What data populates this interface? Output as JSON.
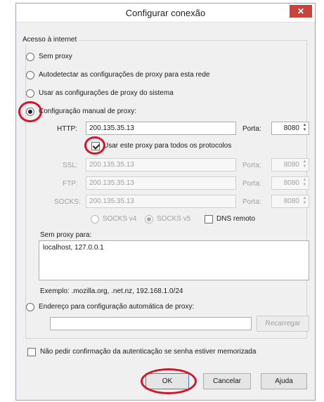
{
  "window": {
    "title": "Configurar conexão",
    "close_glyph": "✕"
  },
  "group": {
    "legend": "Acesso à internet"
  },
  "proxy_mode": {
    "options": [
      {
        "label": "Sem proxy",
        "checked": false
      },
      {
        "label": "Autodetectar as configurações de proxy para esta rede",
        "checked": false
      },
      {
        "label": "Usar as configurações de proxy do sistema",
        "checked": false
      },
      {
        "label": "Configuração manual de proxy:",
        "checked": true
      }
    ]
  },
  "manual": {
    "http": {
      "label": "HTTP:",
      "value": "200.135.35.13",
      "port_label": "Porta:",
      "port": "8080"
    },
    "share_checkbox": {
      "label": "Usar este proxy para todos os protocolos",
      "checked": true
    },
    "ssl": {
      "label": "SSL:",
      "value": "200.135.35.13",
      "port_label": "Porta:",
      "port": "8080"
    },
    "ftp": {
      "label": "FTP:",
      "value": "200.135.35.13",
      "port_label": "Porta:",
      "port": "8080"
    },
    "socks": {
      "label": "SOCKS:",
      "value": "200.135.35.13",
      "port_label": "Porta:",
      "port": "8080"
    },
    "socks_v4": "SOCKS v4",
    "socks_v5": "SOCKS v5",
    "dns_remote": "DNS remoto",
    "no_proxy_label": "Sem proxy para:",
    "no_proxy_value": "localhost, 127.0.0.1",
    "example": "Exemplo: .mozilla.org, .net.nz, 192.168.1.0/24"
  },
  "auto_config": {
    "label": "Endereço para configuração automática de proxy:",
    "url_value": "",
    "reload_label": "Recarregar"
  },
  "auth_checkbox": {
    "label": "Não pedir confirmação da autenticação se senha estiver memorizada",
    "checked": false
  },
  "buttons": {
    "ok": "OK",
    "cancel": "Cancelar",
    "help": "Ajuda"
  },
  "colors": {
    "highlight_ring": "#d3172a",
    "close_button": "#c7433b"
  }
}
